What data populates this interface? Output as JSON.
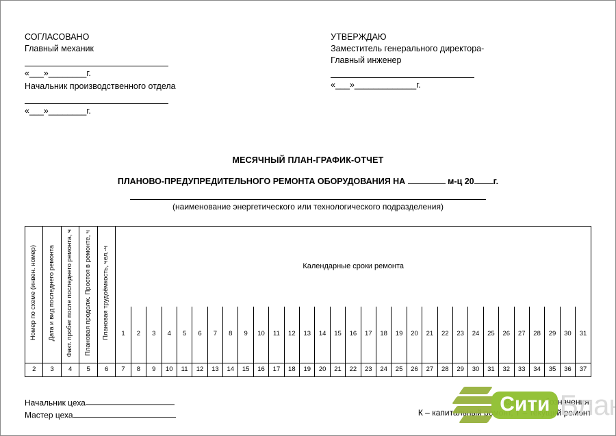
{
  "approvals": {
    "left": {
      "heading": "СОГЛАСОВАНО",
      "role1": "Главный механик",
      "date1": "«___»________г.",
      "role2": "Начальник производственного отдела",
      "date2": "«___»________г."
    },
    "right": {
      "heading": "УТВЕРЖДАЮ",
      "role_line1": "Заместитель генерального директора-",
      "role_line2": "Главный инженер",
      "date": "«___»_____________г."
    }
  },
  "title": {
    "line1": "МЕСЯЧНЫЙ ПЛАН-ГРАФИК-ОТЧЕТ",
    "line2_prefix": "ПЛАНОВО-ПРЕДУПРЕДИТЕЛЬНОГО РЕМОНТА ОБОРУДОВАНИЯ НА ",
    "line2_mid": " м-ц 20",
    "line2_suffix": "г.",
    "subdiv_caption": "(наименование энергетического или технологического подразделения)"
  },
  "table": {
    "cols": [
      "Номер по схеме (инвен. номер)",
      "Дата и вид последнего ремонта",
      "Факт. пробег после последнего ремонта, ч",
      "Плановая продолж. Простоя в ремонте, ч",
      "Плановая трудоёмкость, чел.-ч"
    ],
    "group_header": "Календарные сроки ремонта",
    "days": [
      "1",
      "2",
      "3",
      "4",
      "5",
      "6",
      "7",
      "8",
      "9",
      "10",
      "11",
      "12",
      "13",
      "14",
      "15",
      "16",
      "17",
      "18",
      "19",
      "20",
      "21",
      "22",
      "23",
      "24",
      "25",
      "26",
      "27",
      "28",
      "29",
      "30",
      "31"
    ],
    "col_numbers": [
      "2",
      "3",
      "4",
      "5",
      "6",
      "7",
      "8",
      "9",
      "10",
      "11",
      "12",
      "13",
      "14",
      "15",
      "16",
      "17",
      "18",
      "19",
      "20",
      "21",
      "22",
      "23",
      "24",
      "25",
      "26",
      "27",
      "28",
      "29",
      "30",
      "31",
      "32",
      "33",
      "34",
      "35",
      "36",
      "37"
    ]
  },
  "footer": {
    "chief": "Начальник цеха",
    "master": "Мастер цеха",
    "legend_heading": "Условные обозначения:",
    "legend_text": "К – капитальный ремонт, Т – текущий ремонт"
  },
  "watermark": {
    "badge": "Сити",
    "rest": "Бланк"
  }
}
